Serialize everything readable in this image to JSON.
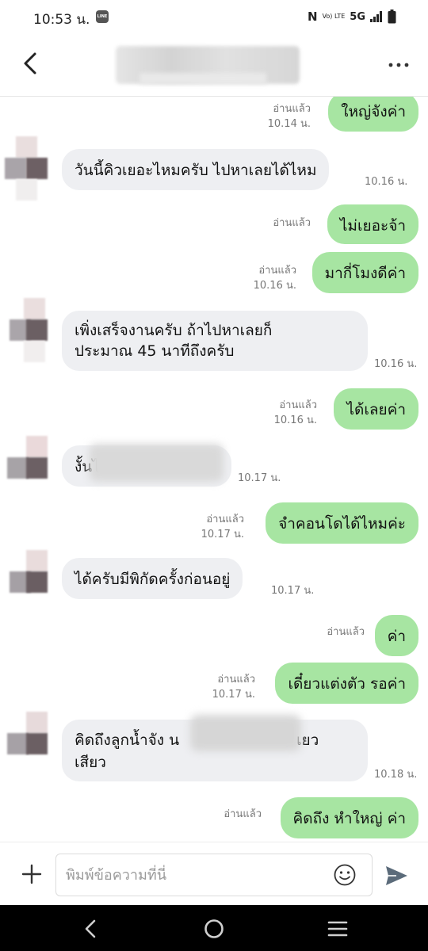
{
  "status_bar": {
    "time": "10:53 น.",
    "line_badge": "LINE",
    "nfc": "N",
    "volte": "Vo) LTE",
    "network": "5G"
  },
  "header": {
    "back_icon": "chevron-left-icon",
    "more_icon": "more-dots-icon"
  },
  "messages": [
    {
      "dir": "out",
      "text": "ใหญ่จังค่า",
      "read": "อ่านแล้ว",
      "time": "10.14 น."
    },
    {
      "dir": "in",
      "text": "วันนี้คิวเยอะไหมครับ  ไปหาเลยได้ไหม",
      "time": "10.16 น."
    },
    {
      "dir": "out",
      "text": "ไม่เยอะจ้า",
      "read": "อ่านแล้ว",
      "time": ""
    },
    {
      "dir": "out",
      "text": "มากี่โมงดีค่า",
      "read": "อ่านแล้ว",
      "time": "10.16 น."
    },
    {
      "dir": "in",
      "text": "เพิ่งเสร็จงานครับ  ถ้าไปหาเลยก็",
      "text2": "ประมาณ 45 นาทีถึงครับ",
      "time": "10.16 น."
    },
    {
      "dir": "out",
      "text": "ได้เลยค่า",
      "read": "อ่านแล้ว",
      "time": "10.16 น."
    },
    {
      "dir": "in",
      "text": "งั้นไ",
      "time": "10.17 น."
    },
    {
      "dir": "out",
      "text": "จำคอนโดได้ไหมค่ะ",
      "read": "อ่านแล้ว",
      "time": "10.17 น."
    },
    {
      "dir": "in",
      "text": "ได้ครับมีพิกัดครั้งก่อนอยู่",
      "time": "10.17 น."
    },
    {
      "dir": "out",
      "text": "ค่า",
      "read": "อ่านแล้ว",
      "time": ""
    },
    {
      "dir": "out",
      "text": "เดี๋ยวแต่งตัว รอค่า",
      "read": "อ่านแล้ว",
      "time": "10.17 น."
    },
    {
      "dir": "in",
      "text": "คิดถึงลูกน้ำจัง  น",
      "text_tail": "เยว",
      "text2": "เสียว",
      "time": "10.18 น."
    },
    {
      "dir": "out",
      "text": "คิดถึง หำใหญ่ ค่า",
      "read": "อ่านแล้ว",
      "time": ""
    }
  ],
  "input_bar": {
    "placeholder": "พิมพ์ข้อความที่นี่",
    "add_icon": "plus-icon",
    "emoji_icon": "smiley-icon",
    "send_icon": "send-icon"
  },
  "nav_bar": {
    "back_icon": "nav-back-icon",
    "home_icon": "nav-home-icon",
    "recents_icon": "nav-recents-icon"
  },
  "colors": {
    "outgoing_bubble": "#a7e5a2",
    "incoming_bubble": "#eeeff2",
    "meta_text": "#777777",
    "nav_bar": "#000000"
  }
}
